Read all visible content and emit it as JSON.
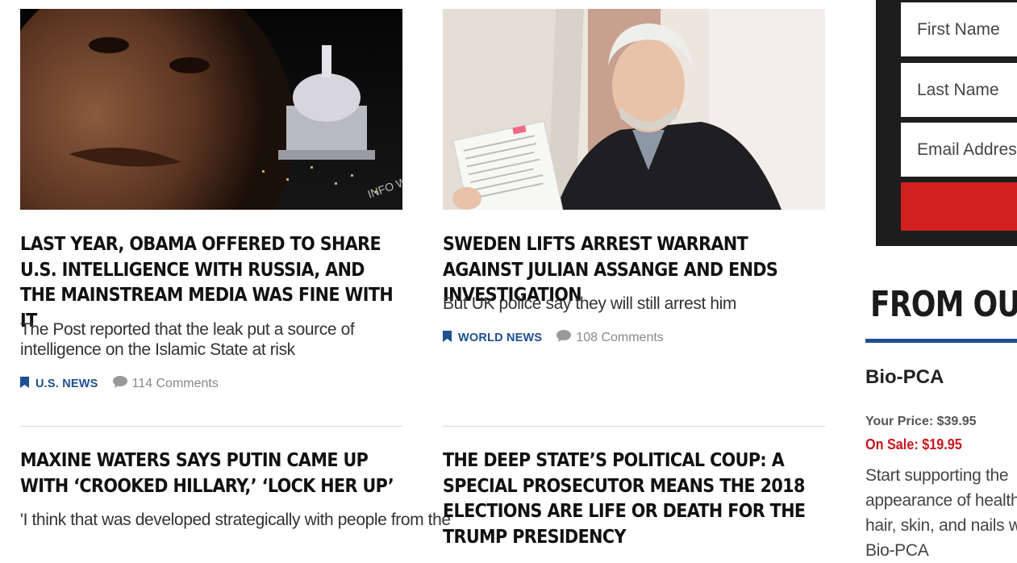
{
  "articles": [
    {
      "headline": "LAST YEAR, OBAMA OFFERED TO SHARE U.S. INTELLIGENCE WITH RUSSIA, AND THE MAINSTREAM MEDIA WAS FINE WITH IT",
      "dek": "The Post reported that the leak put a source of intelligence on the Islamic State at risk",
      "category": "U.S. NEWS",
      "comments": "114 Comments",
      "image_icon": "obama-capitol-photo",
      "image_watermark": "INFO WARS"
    },
    {
      "headline": "SWEDEN LIFTS ARREST WARRANT AGAINST JULIAN ASSANGE AND ENDS INVESTIGATION",
      "dek": "But UK police say they will still arrest him",
      "category": "WORLD NEWS",
      "comments": "108 Comments",
      "image_icon": "assange-document-photo"
    },
    {
      "headline": "MAXINE WATERS SAYS PUTIN CAME UP WITH ‘CROOKED HILLARY,’ ‘LOCK HER UP’",
      "dek": "'I think that was developed strategically with people from the"
    },
    {
      "headline": "THE DEEP STATE’S POLITICAL COUP: A SPECIAL PROSECUTOR MEANS THE 2018 ELECTIONS ARE LIFE OR DEATH FOR THE TRUMP PRESIDENCY"
    }
  ],
  "signup": {
    "first_name_placeholder": "First Name",
    "last_name_placeholder": "Last Name",
    "email_placeholder": "Email Address"
  },
  "sidebar": {
    "section_title": "FROM OUR",
    "product": {
      "name": "Bio-PCA",
      "price_label": "Your Price: $39.95",
      "sale_label": "On Sale: $19.95",
      "description": "Start supporting the appearance of healthy hair, skin, and nails with Bio-PCA"
    }
  },
  "colors": {
    "category_blue": "#1d4f91",
    "sale_red": "#c8161d",
    "signup_bg": "#1d1d1d",
    "submit_red": "#d21f1f"
  }
}
